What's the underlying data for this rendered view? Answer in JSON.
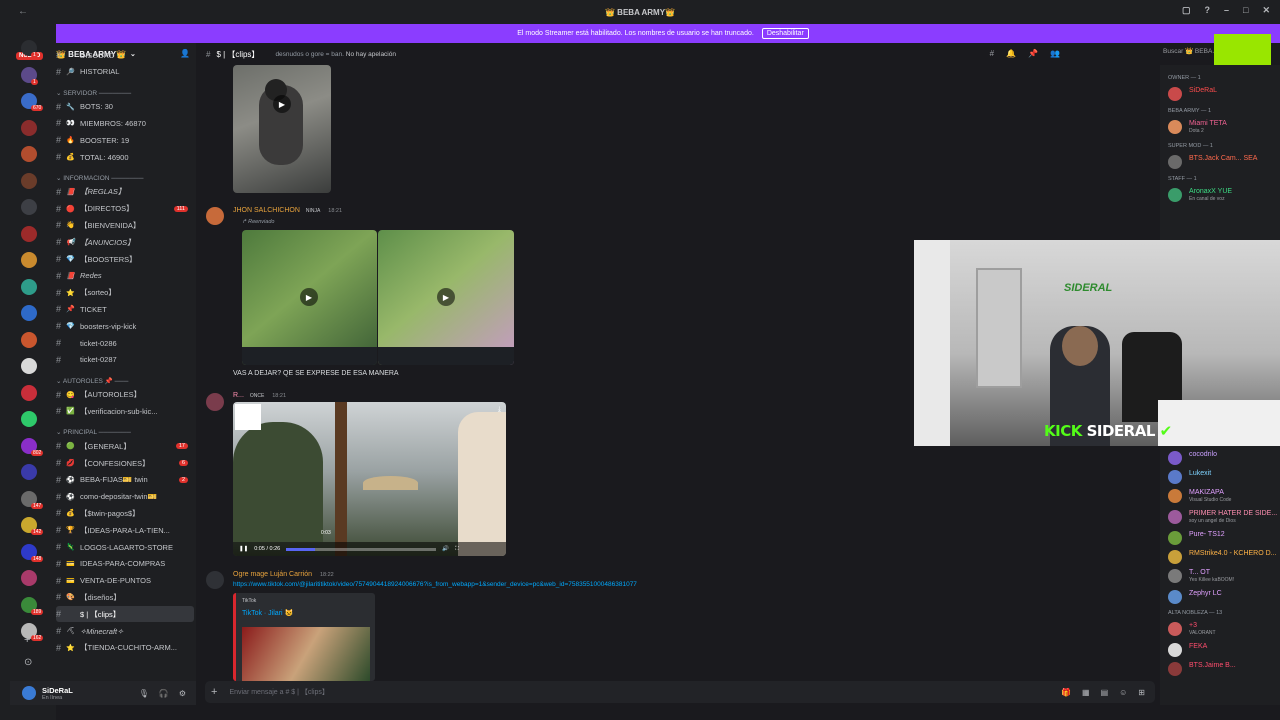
{
  "window": {
    "title": "👑 BEBA ARMY👑"
  },
  "banner": {
    "text": "El modo Streamer está habilitado. Los nombres de usuario se han truncado.",
    "button": "Deshabilitar"
  },
  "guilds": {
    "new_badge": "NUEVO",
    "badges": [
      "1",
      "1",
      "670",
      "",
      "",
      "",
      "",
      "",
      "",
      "",
      "",
      "",
      "",
      "",
      "",
      "802",
      "",
      "147",
      "142",
      "148",
      "",
      "189",
      "162"
    ]
  },
  "server": {
    "name": "👑 BEBA ARMY👑"
  },
  "channels": {
    "top": [
      {
        "name": "DISCORD",
        "icon": "",
        "type": "hash"
      },
      {
        "name": "HISTORIAL",
        "icon": "🔎",
        "type": "hash"
      }
    ],
    "servidor_cat": "SERVIDOR ───────",
    "servidor": [
      {
        "name": "BOTS: 30",
        "icon": "🔧"
      },
      {
        "name": "MIEMBROS: 46870",
        "icon": "👀"
      },
      {
        "name": "BOOSTER: 19",
        "icon": "🔥"
      },
      {
        "name": "TOTAL: 46900",
        "icon": "💰"
      }
    ],
    "info_cat": "INFORMACION ───────",
    "info": [
      {
        "name": "【REGLAS】",
        "icon": "📕",
        "italic": true
      },
      {
        "name": "【DIRECTOS】",
        "icon": "🔴",
        "badge": "111"
      },
      {
        "name": "【BIENVENIDA】",
        "icon": "👋"
      },
      {
        "name": "【ANUNCIOS】",
        "icon": "📢",
        "italic": true
      },
      {
        "name": "【BOOSTERS】",
        "icon": "💎"
      },
      {
        "name": "Redes",
        "icon": "📕",
        "italic": true
      },
      {
        "name": "【sorteo】",
        "icon": "⭐"
      },
      {
        "name": "TICKET",
        "icon": "📌"
      },
      {
        "name": "boosters-vip-kick",
        "icon": "💎"
      },
      {
        "name": "ticket-0286",
        "icon": ""
      },
      {
        "name": "ticket-0287",
        "icon": ""
      }
    ],
    "autoroles_cat": "AUTOROLES 📌 ───",
    "autoroles": [
      {
        "name": "【AUTOROLES】",
        "icon": "😋"
      },
      {
        "name": "【verificacion-sub-kic...",
        "icon": "✅"
      }
    ],
    "principal_cat": "PRINCIPAL ───────",
    "principal": [
      {
        "name": "【GENERAL】",
        "icon": "🟢",
        "badge": "17"
      },
      {
        "name": "【CONFESIONES】",
        "icon": "💋",
        "badge": "6"
      },
      {
        "name": "BEBA-FIJAS🎫 twin",
        "icon": "⚽",
        "badge": "2"
      },
      {
        "name": "como-depositar-twin🎫",
        "icon": "⚽"
      },
      {
        "name": "【$twin-pagos$】",
        "icon": "💰"
      },
      {
        "name": "【IDEAS-PARA-LA-TIEN...",
        "icon": "🏆"
      },
      {
        "name": "LOGOS-LAGARTO-STORE",
        "icon": "🦎"
      },
      {
        "name": "IDEAS-PARA-COMPRAS",
        "icon": "💳"
      },
      {
        "name": "VENTA-DE-PUNTOS",
        "icon": "💳"
      },
      {
        "name": "【diseños】",
        "icon": "🎨"
      },
      {
        "name": "$ | 【clips】",
        "icon": "",
        "active": true
      },
      {
        "name": "✧Minecraft✧",
        "icon": "⛏",
        "italic": true
      },
      {
        "name": "【TIENDA-CUCHITO-ARM...",
        "icon": "⭐"
      }
    ]
  },
  "user": {
    "name": "SiDeRaL",
    "status": "En línea"
  },
  "chat_header": {
    "channel": "$ | 【clips】",
    "topic_pre": "desnudos o gore = ban.",
    "topic_bold": "No hay apelación"
  },
  "search": {
    "placeholder": "Buscar 👑 BEBA ARMY"
  },
  "messages": [
    {
      "author": "JHON SALCHICHON",
      "badge": "NINJA",
      "time": "18:21",
      "note": "Reenviado",
      "text": "VAS A DEJAR? QE SE EXPRESE DE ESA MANERA"
    },
    {
      "author": "R...",
      "badge": "ONCE",
      "time": "18:21",
      "video_time": "0:05 / 0:26",
      "scrub": "0:03"
    },
    {
      "author": "Ogre mage Luján Carrión",
      "time": "18:22",
      "link": "https://www.tiktok.com/@jilarititiktok/video/7574904418924006676?is_from_webapp=1&sender_device=pc&web_id=7583551000486381077",
      "embed_source": "TikTok",
      "embed_title": "TikTok · Jilari 😺"
    }
  ],
  "composer": {
    "placeholder": "Enviar mensaje a # $ | 【clips】"
  },
  "members": {
    "groups": [
      {
        "label": "OWNER — 1",
        "items": [
          {
            "name": "SiDeRaL",
            "color": "#ff4d4d"
          }
        ]
      },
      {
        "label": "BEBA ARMY — 1",
        "items": [
          {
            "name": "Miami",
            "sub": "Dota 2",
            "tag": "TETA",
            "color": "#f06292"
          }
        ]
      },
      {
        "label": "SUPER MOD — 1",
        "items": [
          {
            "name": "BTS.Jack Cam...",
            "tag": "SEA",
            "color": "#ff6a4d"
          }
        ]
      },
      {
        "label": "STAFF — 1",
        "items": [
          {
            "name": "AronaxX",
            "sub": "En canal de voz",
            "tag": "YUE",
            "color": "#3ddc84"
          }
        ]
      }
    ],
    "online": [
      {
        "name": "cocodrilo",
        "color": "#c9a0ff"
      },
      {
        "name": "Lukexit",
        "color": "#7fd3ff"
      },
      {
        "name": "MAKIZAPA",
        "sub": "Visual Studio Code",
        "color": "#e0a0ff"
      },
      {
        "name": "PRIMER HATER DE SIDE...",
        "sub": "soy un angel de Dios",
        "color": "#ff8fb1"
      },
      {
        "name": "Pure-",
        "tag": "TS12",
        "color": "#e0a0ff"
      },
      {
        "name": "RMStrike4.0 - KCHERO D...",
        "color": "#ffb347"
      },
      {
        "name": "T...",
        "sub": "Yes Killee kaBOOM!",
        "tag": "OT",
        "color": "#e0a0ff"
      },
      {
        "name": "Zephyr",
        "tag": "LC",
        "color": "#e0a0ff"
      }
    ],
    "alta": {
      "label": "ALTA NOBLEZA — 13",
      "items": [
        {
          "name": "+3",
          "sub": "VALORANT",
          "color": "#ff4d6d"
        },
        {
          "name": "FEKA",
          "color": "#ff4d6d"
        },
        {
          "name": "BTS.Jaime B...",
          "color": "#ff4d6d"
        }
      ]
    }
  },
  "webcam": {
    "brand": "KICK",
    "name": "SIDERAL",
    "wall_text": "SIDERAL"
  }
}
